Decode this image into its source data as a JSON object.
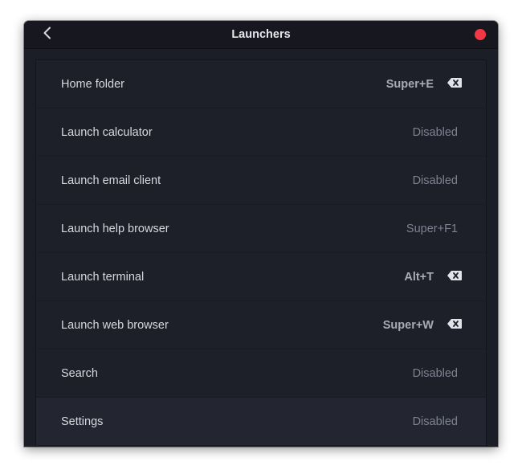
{
  "window": {
    "title": "Launchers",
    "back_icon": "chevron-left-icon",
    "close_icon": "close-icon",
    "accent_close": "#f23844"
  },
  "shortcuts": [
    {
      "label": "Home folder",
      "accel": "Super+E",
      "set": true
    },
    {
      "label": "Launch calculator",
      "accel": "Disabled",
      "set": false
    },
    {
      "label": "Launch email client",
      "accel": "Disabled",
      "set": false
    },
    {
      "label": "Launch help browser",
      "accel": "Super+F1",
      "set": false
    },
    {
      "label": "Launch terminal",
      "accel": "Alt+T",
      "set": true
    },
    {
      "label": "Launch web browser",
      "accel": "Super+W",
      "set": true
    },
    {
      "label": "Search",
      "accel": "Disabled",
      "set": false
    },
    {
      "label": "Settings",
      "accel": "Disabled",
      "set": false
    }
  ]
}
